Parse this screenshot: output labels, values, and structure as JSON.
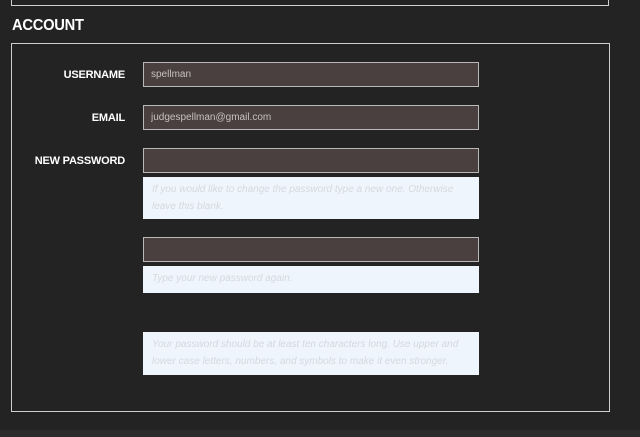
{
  "section": {
    "title": "ACCOUNT"
  },
  "form": {
    "username": {
      "label": "USERNAME",
      "value": "spellman"
    },
    "email": {
      "label": "EMAIL",
      "value": "judgespellman@gmail.com"
    },
    "new_password": {
      "label": "NEW PASSWORD",
      "value": "",
      "help": "If you would like to change the password type a new one. Otherwise leave this blank."
    },
    "confirm_password": {
      "value": "",
      "help": "Type your new password again."
    },
    "strength_hint": "Your password should be at least ten characters long. Use upper and lower case letters, numbers, and symbols to make it even stronger."
  },
  "colors": {
    "background": "#232323",
    "input_bg": "#4a403f",
    "help_bg": "#eef5fd",
    "border": "#cfcfcf"
  }
}
